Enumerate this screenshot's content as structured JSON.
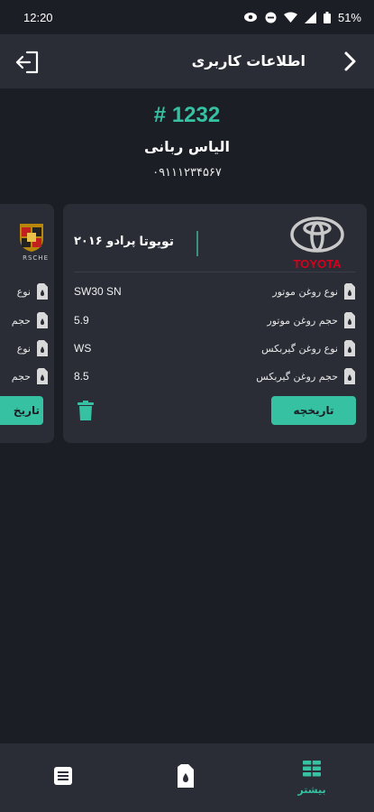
{
  "status_bar": {
    "time": "12:20",
    "battery": "51%"
  },
  "app_bar": {
    "title": "اطلاعات کاربری"
  },
  "profile": {
    "id": "# 1232",
    "name": "الیاس ربانی",
    "phone": "۰۹۱۱۱۲۳۴۵۶۷"
  },
  "cars": [
    {
      "brand": "تویوتا",
      "model": "پرادو ۲۰۱۶",
      "logo_text": "TOYOTA",
      "specs": [
        {
          "label": "نوع روغن موتور",
          "value": "SW30 SN"
        },
        {
          "label": "حجم روغن موتور",
          "value": "5.9"
        },
        {
          "label": "نوع روغن گیربکس",
          "value": "WS"
        },
        {
          "label": "حجم روغن گیربکس",
          "value": "8.5"
        }
      ],
      "history_label": "تاریخچه"
    },
    {
      "logo_text": "RSCHE",
      "specs": [
        {
          "label": "نوع"
        },
        {
          "label": "حجم"
        },
        {
          "label": "نوع"
        },
        {
          "label": "حجم"
        }
      ],
      "history_label": "تاریخ"
    }
  ],
  "bottom_nav": {
    "items": [
      {
        "icon": "list-icon"
      },
      {
        "icon": "oil-can-icon"
      },
      {
        "icon": "grid-icon",
        "label": "بیشتر"
      }
    ]
  },
  "colors": {
    "accent": "#36c2a2",
    "surface": "#2a2d36",
    "background": "#1c1e26",
    "toyota_red": "#d6001c"
  }
}
